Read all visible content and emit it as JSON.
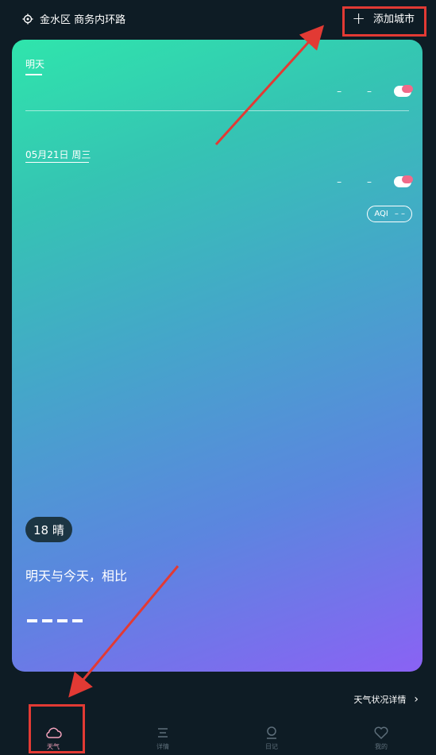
{
  "header": {
    "location": "金水区 商务内环路",
    "add_city": "添加城市",
    "add_icon": "plus-icon"
  },
  "card": {
    "tomorrow_tab": "明天",
    "tomorrow_value": "– –",
    "date": "05月21日  周三",
    "date_value": "– –",
    "aqi_label": "AQI",
    "aqi_value": "– –",
    "temp_badge": "18 晴",
    "compare_text": "明天与今天，相比",
    "gradient_start": "#2fe5ac",
    "gradient_end": "#8a62f4"
  },
  "details_link": "天气状况详情",
  "nav": {
    "items": [
      {
        "label": "天气",
        "icon": "cloud-icon",
        "active": true
      },
      {
        "label": "详情",
        "icon": "list-icon",
        "active": false
      },
      {
        "label": "日记",
        "icon": "person-icon",
        "active": false
      },
      {
        "label": "我的",
        "icon": "heart-icon",
        "active": false
      }
    ]
  },
  "annotation_color": "#e23a34"
}
